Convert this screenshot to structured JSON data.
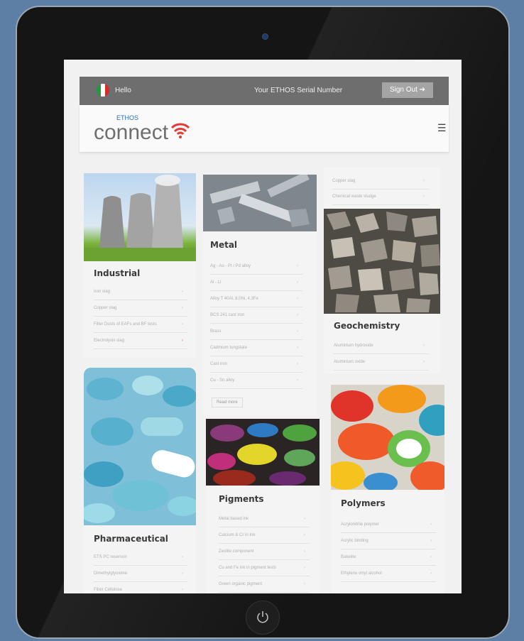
{
  "topbar": {
    "hello": "Hello",
    "serial_label": "Your ETHOS Serial Number",
    "signout": "Sign Out"
  },
  "logo": {
    "ethos": "ETHOS",
    "connect": "connect"
  },
  "colors": {
    "background": "#5d7fa6",
    "topbar": "#6e6e6e",
    "accent": "#2a6fb5",
    "wifi_red": "#e53935"
  },
  "categories": [
    {
      "title": "Industrial",
      "items": [
        "Iron slag",
        "Copper slag",
        "Filter Dusts of EAFs and BF tests",
        "Electrolysis slag"
      ]
    },
    {
      "title": "Metal",
      "items": [
        "Ag - Au - Pt / Pd alloy",
        "Al - Li",
        "Alloy T 40Al, 8.0Ni, 4.3Fe",
        "BCS 241 cast iron",
        "Brass",
        "Cadmium tungstate",
        "Cast iron",
        "Cu - Sn alloy"
      ],
      "read_more": "Read more"
    },
    {
      "title": "Geochemistry",
      "items_top": [
        "Copper slag",
        "Chemical waste sludge"
      ],
      "items": [
        "Aluminium hydroxide",
        "Aluminium oxide"
      ]
    },
    {
      "title": "Pharmaceutical",
      "items": [
        "ETS PC reservoir",
        "Dimethylglyoxime",
        "Fiber Cellulose"
      ]
    },
    {
      "title": "Pigments",
      "items": [
        "Metal based ink",
        "Calcium & Cr in Ink",
        "Zeolite component",
        "Cu and Fe ink in pigment tests",
        "Green organic pigment"
      ]
    },
    {
      "title": "Polymers",
      "items": [
        "Acrylonitrile polymer",
        "Acrylic binding",
        "Bakelite",
        "Ethylene vinyl alcohol"
      ]
    }
  ],
  "icons": [
    "power-icon",
    "wifi-icon",
    "hamburger-icon",
    "chevron-right-icon",
    "italy-flag-icon",
    "arrow-right-icon"
  ]
}
